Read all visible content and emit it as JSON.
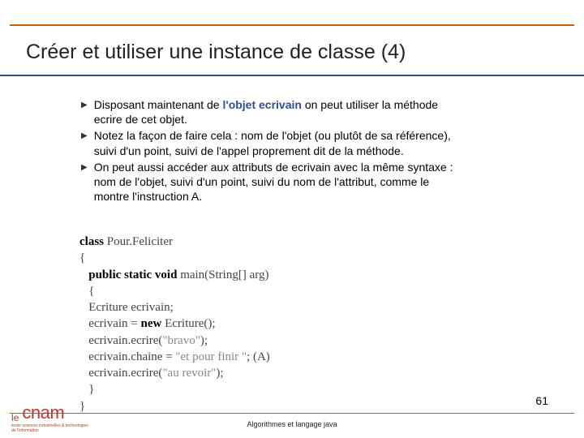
{
  "title": "Créer et utiliser une instance de classe (4)",
  "bullets": {
    "b1_pre": "Disposant maintenant de ",
    "b1_hl": "l'objet ecrivain",
    "b1_post": " on peut utiliser la méthode ecrire de cet objet.",
    "b2": "Notez la façon de faire cela : nom de l'objet (ou plutôt de sa référence), suivi d'un point, suivi de l'appel proprement dit de la méthode.",
    "b3": "On peut aussi accéder aux attributs de ecrivain avec la même syntaxe : nom de l'objet, suivi d'un point, suivi du nom de l'attribut, comme le montre l'instruction A."
  },
  "code": {
    "l1_kw": "class",
    "l1_rest": " Pour.Feliciter",
    "l2": "{",
    "l3_pre": "   ",
    "l3_kw": "public static void",
    "l3_rest": " main(String[] arg)",
    "l4": "   {",
    "l5": "   Ecriture ecrivain;",
    "l6": "",
    "l7_pre": "   ecrivain = ",
    "l7_kw": "new",
    "l7_rest": " Ecriture();",
    "l8_pre": "   ecrivain.ecrire(",
    "l8_str": "\"bravo\"",
    "l8_post": ");",
    "l9_pre": "   ecrivain.chaine = ",
    "l9_str": "\"et pour finir \"",
    "l9_post": "; (A)",
    "l10_pre": "   ecrivain.ecrire(",
    "l10_str": "\"au revoir\"",
    "l10_post": ");",
    "l11": "   }",
    "l12": "}"
  },
  "footer": {
    "center": "Algorithmes et langage java",
    "page": "61",
    "logo_le": "le",
    "logo_cnam": "cnam",
    "logo_sub": "école sciences industrielles & technologies de l'information"
  }
}
